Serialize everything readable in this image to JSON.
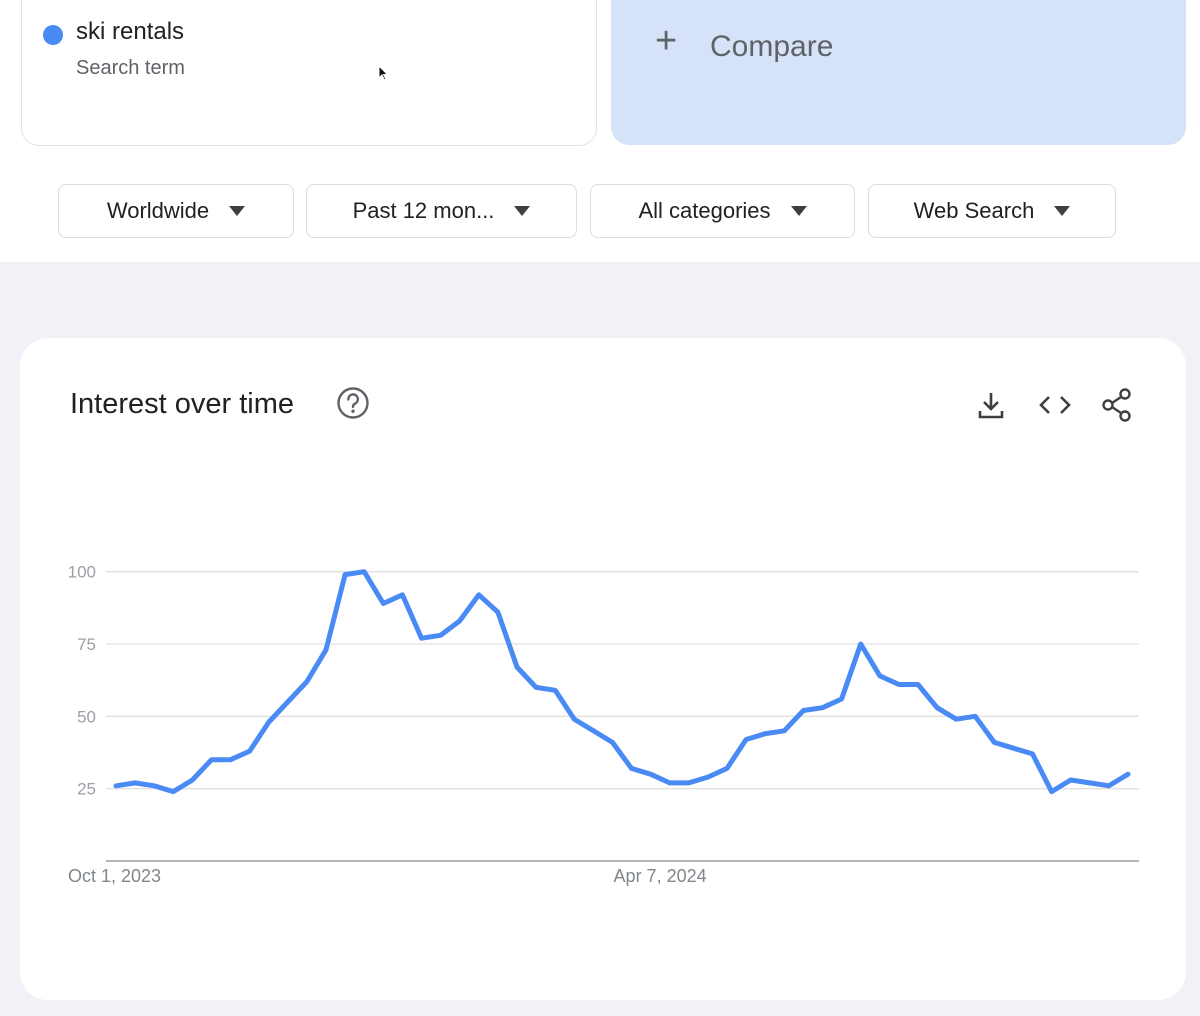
{
  "search_term": {
    "name": "ski rentals",
    "type_label": "Search term",
    "color": "#4a8af4"
  },
  "compare": {
    "icon": "plus-icon",
    "label": "Compare"
  },
  "filters": {
    "region": "Worldwide",
    "time_range": "Past 12 mon...",
    "category": "All categories",
    "search_type": "Web Search"
  },
  "card": {
    "title": "Interest over time",
    "help_icon": "help-icon",
    "actions": [
      "download-icon",
      "embed-code-icon",
      "share-icon"
    ]
  },
  "chart_data": {
    "type": "line",
    "title": "Interest over time",
    "xlabel": "",
    "ylabel": "",
    "ylim": [
      0,
      100
    ],
    "yticks": [
      25,
      50,
      75,
      100
    ],
    "x_tick_labels": [
      "Oct 1, 2023",
      "Apr 7, 2024"
    ],
    "x_tick_indices": [
      0,
      27
    ],
    "grid": true,
    "series": [
      {
        "name": "ski rentals",
        "color": "#4a8af4",
        "values": [
          26,
          27,
          26,
          24,
          28,
          35,
          35,
          38,
          48,
          55,
          62,
          73,
          99,
          100,
          89,
          92,
          77,
          78,
          83,
          92,
          86,
          67,
          60,
          59,
          49,
          45,
          41,
          32,
          30,
          27,
          27,
          29,
          32,
          42,
          44,
          45,
          52,
          53,
          56,
          75,
          64,
          61,
          61,
          53,
          49,
          50,
          41,
          39,
          37,
          24,
          28,
          27,
          26,
          30
        ]
      }
    ]
  }
}
